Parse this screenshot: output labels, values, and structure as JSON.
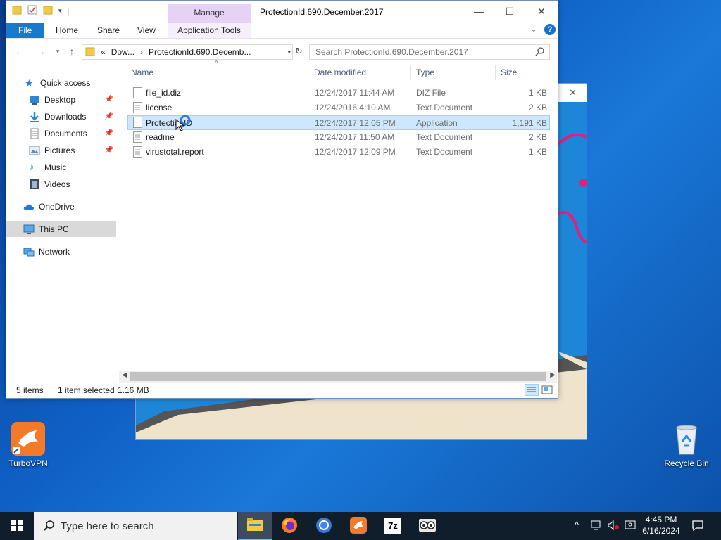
{
  "desktop": {
    "icons": [
      {
        "label": "TurboVPN",
        "icon": "turbovpn-bird-icon"
      },
      {
        "label": "Recycle Bin",
        "icon": "recycle-bin-icon"
      }
    ]
  },
  "background_window": {
    "close_glyph": "✕"
  },
  "explorer": {
    "title": "ProtectionId.690.December.2017",
    "context_tab_group": "Manage",
    "ribbon_tabs": [
      "File",
      "Home",
      "Share",
      "View",
      "Application Tools"
    ],
    "window_controls": {
      "minimize": "—",
      "maximize": "☐",
      "close": "✕"
    },
    "help_glyph": "?",
    "address": {
      "overflow": "«",
      "segments": [
        "Dow...",
        "ProtectionId.690.Decemb..."
      ],
      "separator": "›"
    },
    "search_placeholder": "Search ProtectionId.690.December.2017",
    "nav": {
      "quick_access": "Quick access",
      "items": [
        {
          "label": "Desktop",
          "icon": "desktop-icon",
          "pinned": true
        },
        {
          "label": "Downloads",
          "icon": "downloads-arrow-icon",
          "pinned": true
        },
        {
          "label": "Documents",
          "icon": "documents-icon",
          "pinned": true
        },
        {
          "label": "Pictures",
          "icon": "pictures-icon",
          "pinned": true
        },
        {
          "label": "Music",
          "icon": "music-note-icon",
          "pinned": false
        },
        {
          "label": "Videos",
          "icon": "videos-icon",
          "pinned": false
        }
      ],
      "onedrive": "OneDrive",
      "this_pc": "This PC",
      "network": "Network"
    },
    "columns": {
      "name": "Name",
      "date": "Date modified",
      "type": "Type",
      "size": "Size"
    },
    "files": [
      {
        "name": "file_id.diz",
        "date": "12/24/2017 11:44 AM",
        "type": "DIZ File",
        "size": "1 KB",
        "selected": false
      },
      {
        "name": "license",
        "date": "12/24/2016 4:10 AM",
        "type": "Text Document",
        "size": "2 KB",
        "selected": false
      },
      {
        "name": "ProtectionID",
        "date": "12/24/2017 12:05 PM",
        "type": "Application",
        "size": "1,191 KB",
        "selected": true
      },
      {
        "name": "readme",
        "date": "12/24/2017 11:50 AM",
        "type": "Text Document",
        "size": "2 KB",
        "selected": false
      },
      {
        "name": "virustotal.report",
        "date": "12/24/2017 12:09 PM",
        "type": "Text Document",
        "size": "1 KB",
        "selected": false
      }
    ],
    "status": {
      "count": "5 items",
      "selection": "1 item selected",
      "size": "1.16 MB"
    }
  },
  "taskbar": {
    "search_placeholder": "Type here to search",
    "apps": [
      "file-explorer-icon",
      "firefox-icon",
      "chrome-icon",
      "turbovpn-icon",
      "7zip-icon",
      "protectionid-app-icon"
    ],
    "time": "4:45 PM",
    "date": "6/16/2024"
  },
  "colors": {
    "accent": "#1979ca",
    "selection": "#cce8ff",
    "context_tab": "#e6d2f5",
    "taskbar": "#101e2c"
  }
}
